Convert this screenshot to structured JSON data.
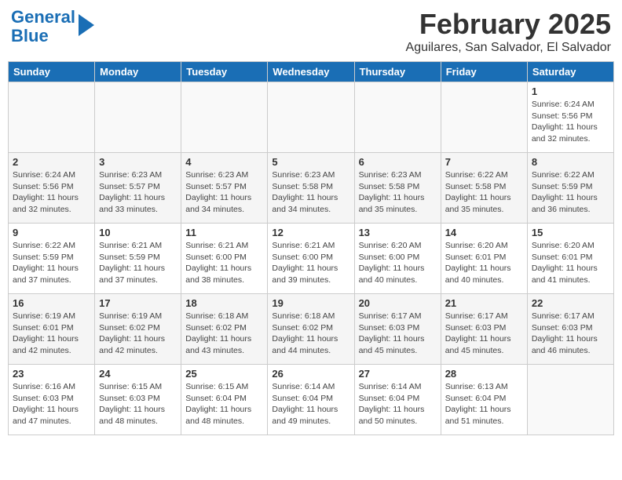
{
  "header": {
    "logo_line1": "General",
    "logo_line2": "Blue",
    "month_title": "February 2025",
    "location": "Aguilares, San Salvador, El Salvador"
  },
  "days_of_week": [
    "Sunday",
    "Monday",
    "Tuesday",
    "Wednesday",
    "Thursday",
    "Friday",
    "Saturday"
  ],
  "weeks": [
    [
      {
        "day": "",
        "info": ""
      },
      {
        "day": "",
        "info": ""
      },
      {
        "day": "",
        "info": ""
      },
      {
        "day": "",
        "info": ""
      },
      {
        "day": "",
        "info": ""
      },
      {
        "day": "",
        "info": ""
      },
      {
        "day": "1",
        "info": "Sunrise: 6:24 AM\nSunset: 5:56 PM\nDaylight: 11 hours and 32 minutes."
      }
    ],
    [
      {
        "day": "2",
        "info": "Sunrise: 6:24 AM\nSunset: 5:56 PM\nDaylight: 11 hours and 32 minutes."
      },
      {
        "day": "3",
        "info": "Sunrise: 6:23 AM\nSunset: 5:57 PM\nDaylight: 11 hours and 33 minutes."
      },
      {
        "day": "4",
        "info": "Sunrise: 6:23 AM\nSunset: 5:57 PM\nDaylight: 11 hours and 34 minutes."
      },
      {
        "day": "5",
        "info": "Sunrise: 6:23 AM\nSunset: 5:58 PM\nDaylight: 11 hours and 34 minutes."
      },
      {
        "day": "6",
        "info": "Sunrise: 6:23 AM\nSunset: 5:58 PM\nDaylight: 11 hours and 35 minutes."
      },
      {
        "day": "7",
        "info": "Sunrise: 6:22 AM\nSunset: 5:58 PM\nDaylight: 11 hours and 35 minutes."
      },
      {
        "day": "8",
        "info": "Sunrise: 6:22 AM\nSunset: 5:59 PM\nDaylight: 11 hours and 36 minutes."
      }
    ],
    [
      {
        "day": "9",
        "info": "Sunrise: 6:22 AM\nSunset: 5:59 PM\nDaylight: 11 hours and 37 minutes."
      },
      {
        "day": "10",
        "info": "Sunrise: 6:21 AM\nSunset: 5:59 PM\nDaylight: 11 hours and 37 minutes."
      },
      {
        "day": "11",
        "info": "Sunrise: 6:21 AM\nSunset: 6:00 PM\nDaylight: 11 hours and 38 minutes."
      },
      {
        "day": "12",
        "info": "Sunrise: 6:21 AM\nSunset: 6:00 PM\nDaylight: 11 hours and 39 minutes."
      },
      {
        "day": "13",
        "info": "Sunrise: 6:20 AM\nSunset: 6:00 PM\nDaylight: 11 hours and 40 minutes."
      },
      {
        "day": "14",
        "info": "Sunrise: 6:20 AM\nSunset: 6:01 PM\nDaylight: 11 hours and 40 minutes."
      },
      {
        "day": "15",
        "info": "Sunrise: 6:20 AM\nSunset: 6:01 PM\nDaylight: 11 hours and 41 minutes."
      }
    ],
    [
      {
        "day": "16",
        "info": "Sunrise: 6:19 AM\nSunset: 6:01 PM\nDaylight: 11 hours and 42 minutes."
      },
      {
        "day": "17",
        "info": "Sunrise: 6:19 AM\nSunset: 6:02 PM\nDaylight: 11 hours and 42 minutes."
      },
      {
        "day": "18",
        "info": "Sunrise: 6:18 AM\nSunset: 6:02 PM\nDaylight: 11 hours and 43 minutes."
      },
      {
        "day": "19",
        "info": "Sunrise: 6:18 AM\nSunset: 6:02 PM\nDaylight: 11 hours and 44 minutes."
      },
      {
        "day": "20",
        "info": "Sunrise: 6:17 AM\nSunset: 6:03 PM\nDaylight: 11 hours and 45 minutes."
      },
      {
        "day": "21",
        "info": "Sunrise: 6:17 AM\nSunset: 6:03 PM\nDaylight: 11 hours and 45 minutes."
      },
      {
        "day": "22",
        "info": "Sunrise: 6:17 AM\nSunset: 6:03 PM\nDaylight: 11 hours and 46 minutes."
      }
    ],
    [
      {
        "day": "23",
        "info": "Sunrise: 6:16 AM\nSunset: 6:03 PM\nDaylight: 11 hours and 47 minutes."
      },
      {
        "day": "24",
        "info": "Sunrise: 6:15 AM\nSunset: 6:03 PM\nDaylight: 11 hours and 48 minutes."
      },
      {
        "day": "25",
        "info": "Sunrise: 6:15 AM\nSunset: 6:04 PM\nDaylight: 11 hours and 48 minutes."
      },
      {
        "day": "26",
        "info": "Sunrise: 6:14 AM\nSunset: 6:04 PM\nDaylight: 11 hours and 49 minutes."
      },
      {
        "day": "27",
        "info": "Sunrise: 6:14 AM\nSunset: 6:04 PM\nDaylight: 11 hours and 50 minutes."
      },
      {
        "day": "28",
        "info": "Sunrise: 6:13 AM\nSunset: 6:04 PM\nDaylight: 11 hours and 51 minutes."
      },
      {
        "day": "",
        "info": ""
      }
    ]
  ]
}
